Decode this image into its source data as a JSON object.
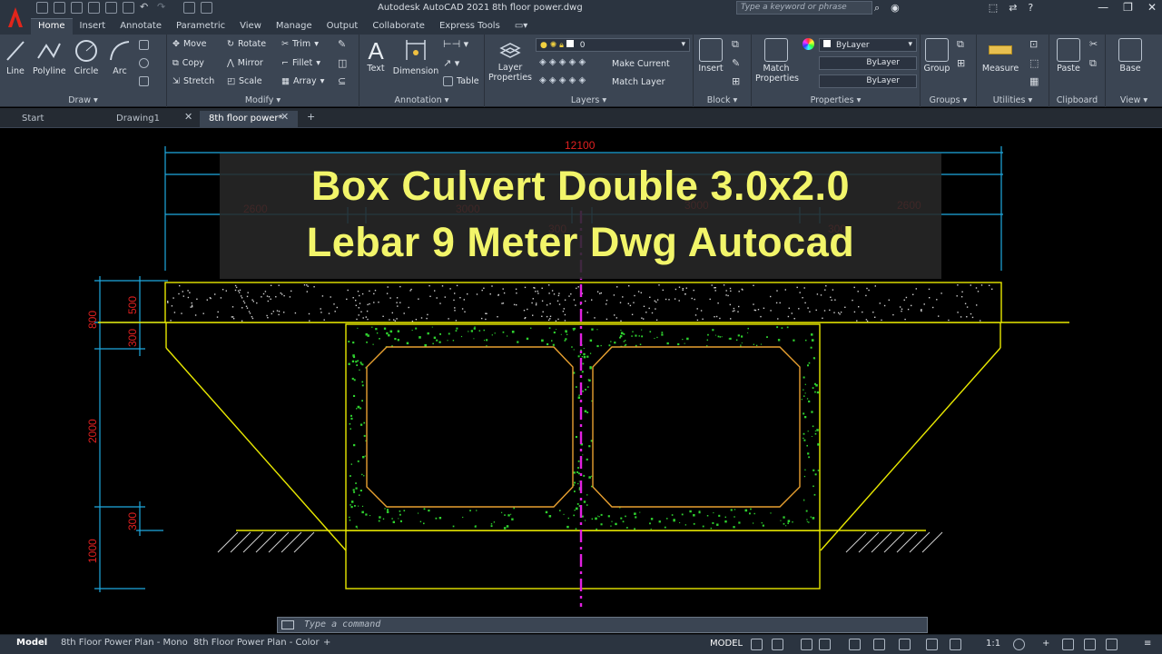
{
  "titlebar": {
    "app_title": "Autodesk AutoCAD 2021",
    "doc_title": "8th floor power.dwg",
    "search_placeholder": "Type a keyword or phrase"
  },
  "ribbon_tabs": [
    "Home",
    "Insert",
    "Annotate",
    "Parametric",
    "View",
    "Manage",
    "Output",
    "Collaborate",
    "Express Tools"
  ],
  "ribbon": {
    "draw": {
      "title": "Draw",
      "line": "Line",
      "polyline": "Polyline",
      "circle": "Circle",
      "arc": "Arc"
    },
    "modify": {
      "title": "Modify",
      "move": "Move",
      "rotate": "Rotate",
      "trim": "Trim",
      "copy": "Copy",
      "mirror": "Mirror",
      "fillet": "Fillet",
      "stretch": "Stretch",
      "scale": "Scale",
      "array": "Array"
    },
    "annotation": {
      "title": "Annotation",
      "text": "Text",
      "dimension": "Dimension",
      "table": "Table"
    },
    "layers": {
      "title": "Layers",
      "layer_properties_1": "Layer",
      "layer_properties_2": "Properties",
      "current_layer": "0",
      "make_current": "Make Current",
      "match_layer": "Match Layer"
    },
    "block": {
      "title": "Block",
      "insert": "Insert"
    },
    "properties": {
      "title": "Properties",
      "match_1": "Match",
      "match_2": "Properties",
      "color": "ByLayer",
      "linetype": "ByLayer",
      "lineweight": "ByLayer"
    },
    "groups": {
      "title": "Groups",
      "group": "Group"
    },
    "utilities": {
      "title": "Utilities",
      "measure": "Measure"
    },
    "clipboard": {
      "title": "Clipboard",
      "paste": "Paste"
    },
    "view": {
      "title": "View",
      "base": "Base"
    }
  },
  "doc_tabs": [
    "Start",
    "Drawing1",
    "8th floor power*"
  ],
  "drawing": {
    "dim_total": "12100",
    "dim_2600_left": "2600",
    "dim_2600_right": "2600",
    "dim_3000_left": "3000",
    "dim_3000_right": "3000",
    "dim_300_a": "300",
    "dim_300_b": "300",
    "dim_500": "500",
    "dim_800": "800",
    "dim_300_v1": "300",
    "dim_2000": "2000",
    "dim_300_v2": "300",
    "dim_1000": "1000",
    "colors": {
      "concrete_outline": "#e8e800",
      "hatch": "#2fd12f",
      "dimension": "#1fa9e0",
      "dim_text": "#e02020",
      "axis": "#e020e0",
      "inner": "#e8a030"
    }
  },
  "overlay": {
    "line1": "Box Culvert Double 3.0x2.0",
    "line2": "Lebar 9 Meter Dwg Autocad"
  },
  "command": {
    "placeholder": "Type a command"
  },
  "statusbar": {
    "layouts": [
      "Model",
      "8th Floor Power Plan - Mono",
      "8th Floor Power Plan - Color"
    ],
    "mode": "MODEL",
    "scale": "1:1"
  }
}
